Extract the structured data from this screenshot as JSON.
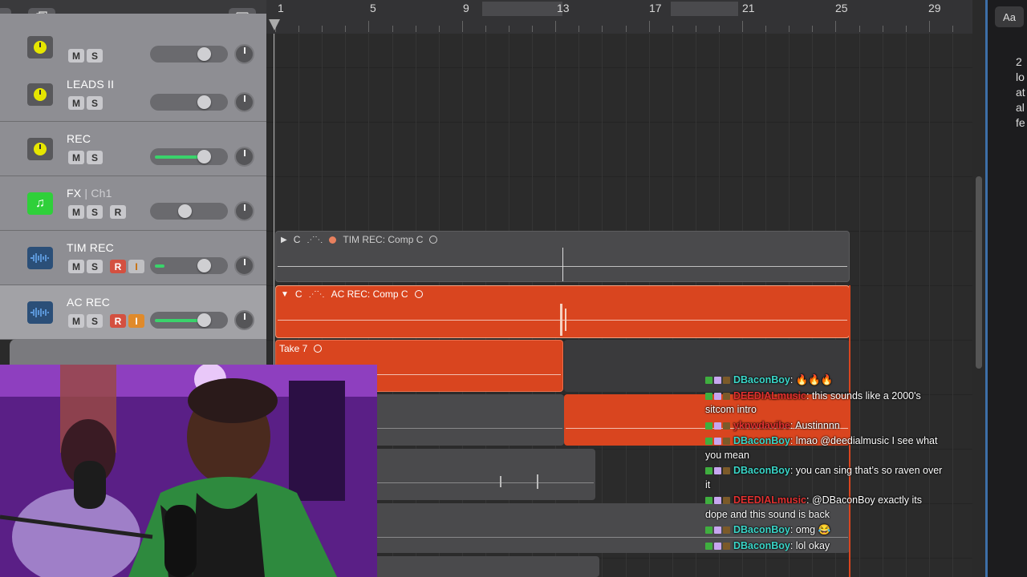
{
  "toolbar": {
    "add_icon": "plus",
    "duplicate_icon": "duplicate",
    "download_icon": "download"
  },
  "tracks": [
    {
      "name": "",
      "icon": "metronome",
      "buttons": [
        "M",
        "S"
      ]
    },
    {
      "name": "LEADS II",
      "icon": "metronome",
      "buttons": [
        "M",
        "S"
      ]
    },
    {
      "name": "REC",
      "icon": "metronome",
      "buttons": [
        "M",
        "S"
      ]
    },
    {
      "name": "FX",
      "sub": " | Ch1",
      "icon": "music-note",
      "buttons": [
        "M",
        "S",
        "R"
      ]
    },
    {
      "name": "TIM REC",
      "icon": "waveform",
      "buttons": [
        "M",
        "S",
        "R",
        "I"
      ]
    },
    {
      "name": "AC REC",
      "icon": "waveform",
      "buttons": [
        "M",
        "S",
        "R",
        "I"
      ]
    }
  ],
  "ruler": {
    "bars": [
      "1",
      "5",
      "9",
      "13",
      "17",
      "21",
      "25",
      "29"
    ]
  },
  "regions": {
    "tim": {
      "play": "▶",
      "c": "C",
      "title": "TIM REC: Comp C"
    },
    "ac": {
      "play": "▼",
      "c": "C",
      "title": "AC REC: Comp C"
    },
    "take7": {
      "title": "Take 7"
    }
  },
  "right_panel": {
    "aa": "Aa",
    "text": "2\nlo\nat\nal\nfe"
  },
  "chat": [
    {
      "user": "DBaconBoy",
      "color": "#3ad6c8",
      "sep": ": ",
      "text": "🔥🔥🔥"
    },
    {
      "user": "DEEDIALmusic",
      "color": "#e23030",
      "sep": ": ",
      "text": "this sounds like a 2000's sitcom intro"
    },
    {
      "user": "yknwdavibe",
      "color": "#e23030",
      "sep": ": ",
      "text": "Austinnnn"
    },
    {
      "user": "DBaconBoy",
      "color": "#3ad6c8",
      "sep": ": ",
      "text": "lmao @deedialmusic I see what you mean"
    },
    {
      "user": "DBaconBoy",
      "color": "#3ad6c8",
      "sep": ": ",
      "text": "you can sing that’s so raven over it"
    },
    {
      "user": "DEEDIALmusic",
      "color": "#e23030",
      "sep": ": ",
      "text": "@DBaconBoy exactly its dope and this sound is back"
    },
    {
      "user": "DBaconBoy",
      "color": "#3ad6c8",
      "sep": ": ",
      "text": "omg 😂"
    },
    {
      "user": "DBaconBoy",
      "color": "#3ad6c8",
      "sep": ": ",
      "text": "lol okay"
    }
  ],
  "colors": {
    "region_orange": "#d9451f",
    "region_gray": "#4a4a4c",
    "selection_blue": "#3d6fa8"
  }
}
